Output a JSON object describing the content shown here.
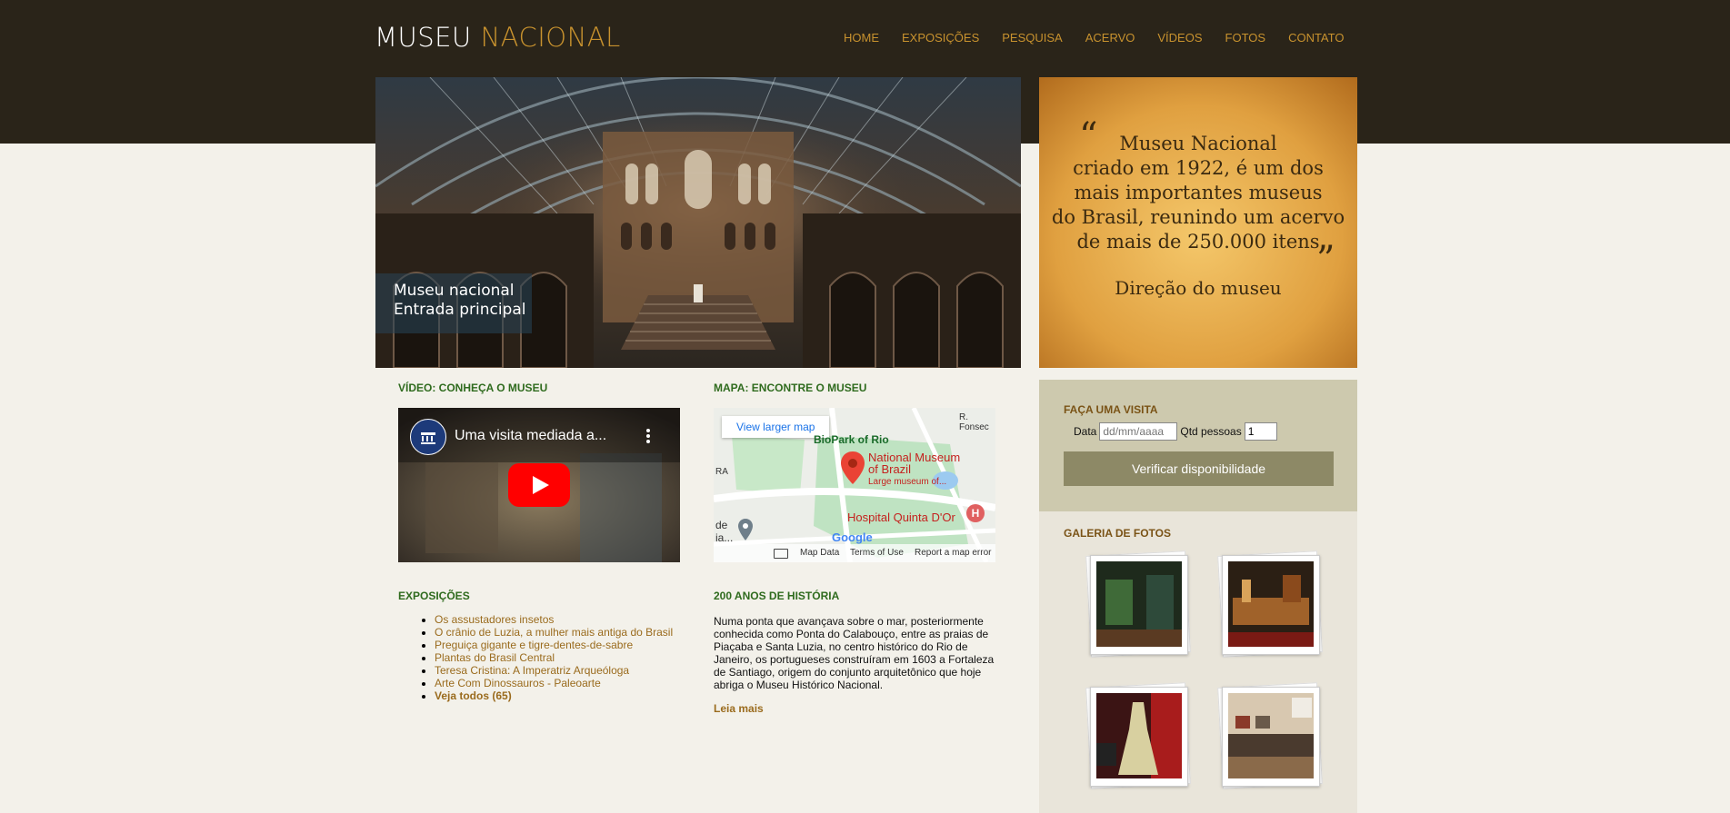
{
  "header": {
    "logo_part1": "MUSEU",
    "logo_part2": "NACIONAL",
    "nav": [
      "HOME",
      "EXPOSIÇÕES",
      "PESQUISA",
      "ACERVO",
      "VÍDEOS",
      "FOTOS",
      "CONTATO"
    ]
  },
  "hero": {
    "caption_line1": "Museu nacional",
    "caption_line2": "Entrada principal"
  },
  "quote": {
    "open": "“",
    "close": "”",
    "lines": [
      "Museu Nacional",
      "criado em 1922, é um dos",
      "mais importantes museus",
      "do Brasil, reunindo um acervo",
      "de mais de 250.000 itens"
    ],
    "author": "Direção do museu"
  },
  "video": {
    "section_title": "VÍDEO: CONHEÇA O MUSEU",
    "title": "Uma visita mediada a..."
  },
  "map": {
    "section_title": "MAPA: ENCONTRE O MUSEU",
    "larger_map": "View larger map",
    "place_name_1": "National Museum",
    "place_name_2": "of Brazil",
    "place_sub": "Large museum of...",
    "biopark": "BioPark of Rio",
    "hospital": "Hospital Quinta D'Or",
    "road": "R. Fonsec",
    "edge_1": "RA",
    "edge_2": "de",
    "edge_3": "ia...",
    "google": "Google",
    "map_data": "Map Data",
    "terms": "Terms of Use",
    "report": "Report a map error"
  },
  "exhibitions": {
    "section_title": "EXPOSIÇÕES",
    "items": [
      "Os assustadores insetos",
      "O crânio de Luzia, a mulher mais antiga do Brasil",
      "Preguiça gigante e tigre-dentes-de-sabre",
      "Plantas do Brasil Central",
      "Teresa Cristina: A Imperatriz Arqueóloga",
      "Arte Com Dinossauros - Paleoarte"
    ],
    "see_all": "Veja todos (65)"
  },
  "history": {
    "section_title": "200 ANOS DE HISTÓRIA",
    "text": "Numa ponta que avançava sobre o mar, posteriormente conhecida como Ponta do Calabouço, entre as praias de Piaçaba e Santa Luzia, no centro histórico do Rio de Janeiro, os portugueses construíram em 1603 a Fortaleza de Santiago, origem do conjunto arquitetônico que hoje abriga o Museu Histórico Nacional.",
    "read_more": "Leia mais"
  },
  "visit": {
    "section_title": "FAÇA UMA VISITA",
    "date_label": "Data",
    "date_placeholder": "dd/mm/aaaa",
    "people_label": "Qtd pessoas",
    "people_value": "1",
    "button": "Verificar disponibilidade"
  },
  "gallery": {
    "section_title": "GALERIA DE FOTOS"
  },
  "colors": {
    "header_bg": "#2a2419",
    "accent": "#c8922e",
    "section_green": "#2f6b1e",
    "link_brown": "#9a6b1d"
  }
}
